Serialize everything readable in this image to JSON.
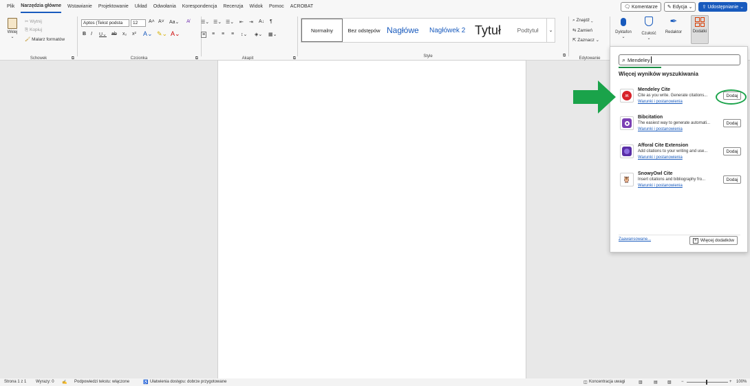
{
  "menubar": {
    "tabs": [
      "Plik",
      "Narzędzia główne",
      "Wstawianie",
      "Projektowanie",
      "Układ",
      "Odwołania",
      "Korespondencja",
      "Recenzja",
      "Widok",
      "Pomoc",
      "ACROBAT"
    ],
    "active_tab": "Narzędzia główne",
    "comments": "Komentarze",
    "editing": "Edycja",
    "share": "Udostępnianie"
  },
  "ribbon": {
    "clipboard": {
      "paste": "Wklej",
      "cut": "Wytnij",
      "copy": "Kopiuj",
      "format_painter": "Malarz formatów",
      "label": "Schowek"
    },
    "font": {
      "family": "Aptos (Tekst podsta",
      "size": "12",
      "label": "Czcionka"
    },
    "paragraph": {
      "label": "Akapit"
    },
    "styles": {
      "items": [
        "Normalny",
        "Bez odstępów",
        "Nagłówe",
        "Nagłówek 2",
        "Tytuł",
        "Podtytuł"
      ],
      "label": "Style"
    },
    "editing": {
      "find": "Znajdź",
      "replace": "Zamień",
      "select": "Zaznacz",
      "label": "Edytowanie"
    },
    "voice": {
      "dictate": "Dyktafon"
    },
    "sensitivity": "Czułość",
    "editor": "Redaktor",
    "addins": "Dodatki"
  },
  "statusbar": {
    "page": "Strona 1 z 1",
    "words": "Wyrazy: 0",
    "text_predictions": "Podpowiedzi tekstu: włączone",
    "accessibility": "Ułatwienia dostępu: dobrze przygotowane",
    "focus": "Koncentracja uwagi",
    "zoom": "100%"
  },
  "addins_pane": {
    "search_value": "Mendeley",
    "section_title": "Więcej wyników wyszukiwania",
    "items": [
      {
        "name": "Mendeley Cite",
        "desc": "Cite as you write. Generate citations...",
        "terms": "Warunki i postanowienia",
        "add": "Dodaj",
        "logo_color": "#d8232a"
      },
      {
        "name": "Bibcitation",
        "desc": "The easiest way to generate automati...",
        "terms": "Warunki i postanowienia",
        "add": "Dodaj",
        "logo_color": "#7b3fb4"
      },
      {
        "name": "Afforal Cite Extension",
        "desc": "Add citations to your writing and use...",
        "terms": "Warunki i postanowienia",
        "add": "Dodaj",
        "logo_color": "#5a2ea6"
      },
      {
        "name": "SnowyOwl Cite",
        "desc": "Insert citations and bibliography fro...",
        "terms": "Warunki i postanowienia",
        "add": "Dodaj",
        "logo_color": "#e0a020"
      }
    ],
    "advanced": "Zaawansowane...",
    "more": "Więcej dodatków"
  },
  "colors": {
    "accent": "#185abd",
    "highlight_green": "#1aa34a",
    "page_bg": "#e8e8e8"
  }
}
